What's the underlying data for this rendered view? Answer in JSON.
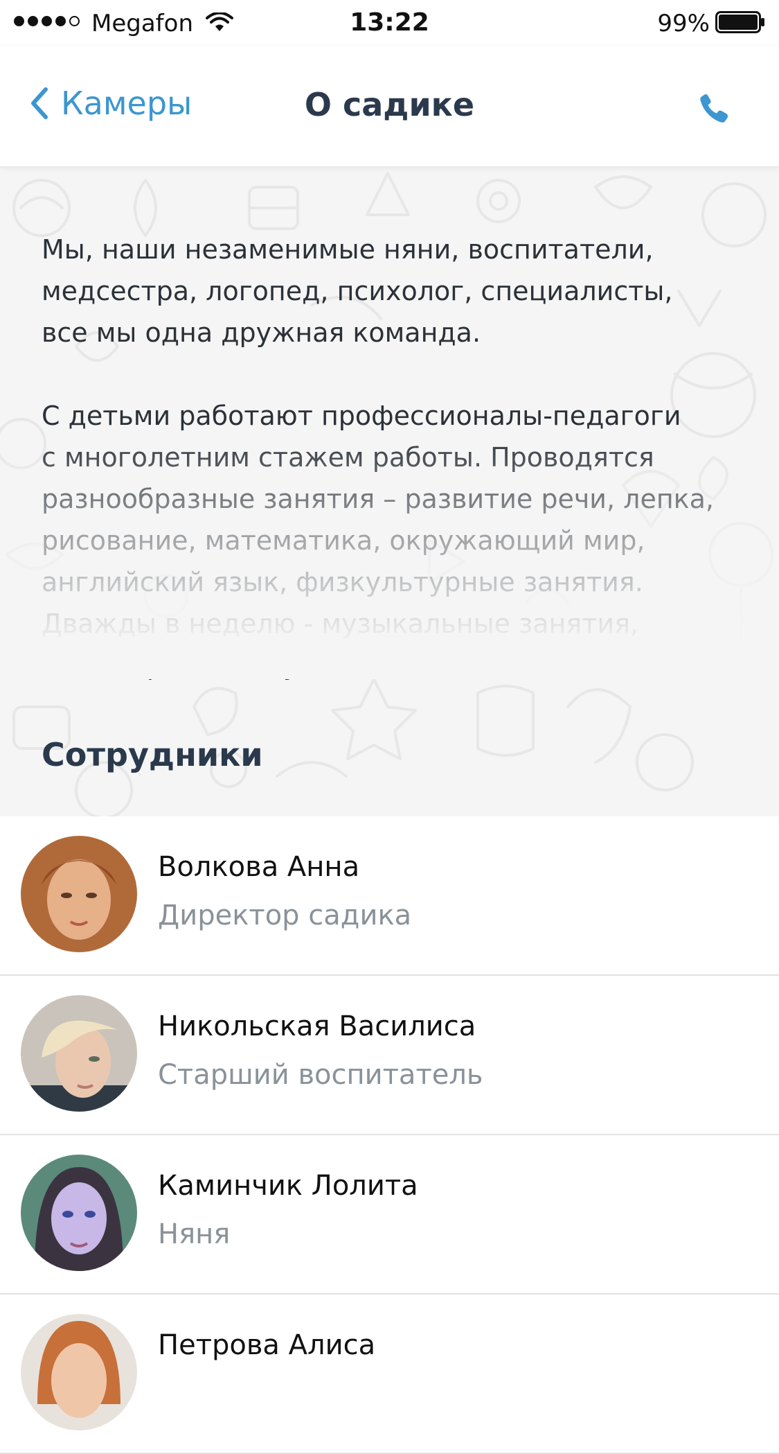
{
  "status_bar": {
    "carrier": "Megafon",
    "time": "13:22",
    "battery": "99%",
    "icons": [
      "signal-dots-icon",
      "wifi-icon",
      "battery-icon"
    ]
  },
  "nav": {
    "back_label": "Камеры",
    "title": "О садике",
    "icons": [
      "chevron-left-icon",
      "phone-icon"
    ],
    "accent_color": "#3c96d1"
  },
  "about": {
    "paragraphs": [
      "Мы, наши незаменимые няни, воспитатели,\nмедсестра, логопед, психолог, специалисты,\nвсе мы одна дружная команда.",
      "С детьми работают профессионалы-педагоги\nс многолетним стажем работы. Проводятся\nразнообразные занятия – развитие речи, лепка,\nрисование, математика, окружающий мир,\nанглийский язык,  физкультурные занятия.\nДважды в неделю - музыкальные занятия,\nна которых дети учатся петь и танцевать."
    ]
  },
  "staff": {
    "heading": "Сотрудники",
    "members": [
      {
        "name": "Волкова Анна",
        "role": "Директор садика"
      },
      {
        "name": "Никольская Василиса",
        "role": "Старший воспитатель"
      },
      {
        "name": "Каминчик Лолита",
        "role": "Няня"
      },
      {
        "name": "Петрова Алиса",
        "role": ""
      }
    ]
  }
}
